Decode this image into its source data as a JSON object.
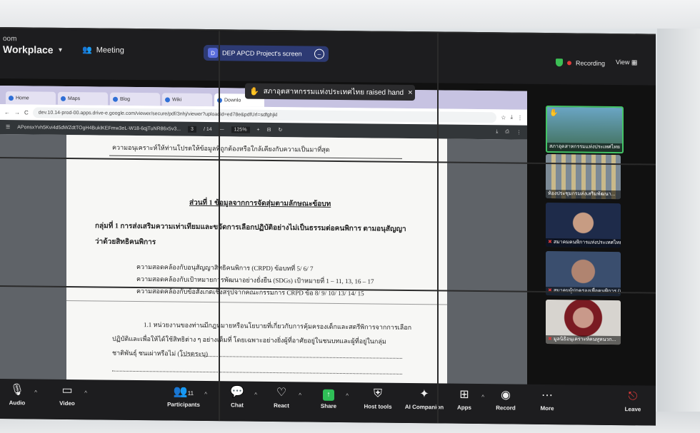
{
  "zoom": {
    "brand_line1": "oom",
    "brand_line2": "Workplace",
    "meeting_label": "Meeting",
    "share_badge": "D",
    "share_title": "DEP APCD Project's screen",
    "recording_label": "Recording",
    "view_label": "View"
  },
  "toast": {
    "text": "สภาอุตสาหกรรมแห่งประเทศไทย raised hand"
  },
  "browser": {
    "tabs": [
      "Home",
      "Maps",
      "Blog",
      "Wiki",
      "Downlo"
    ],
    "url": "dev.10.14-prod-00.apps.drive-e.google.com/viewer/secure/pdf/3nhj/viewer?uploadid=ed78e&pdfUrl=sdfghjkl",
    "pdf_name": "APonsxYvh5Kvi4d5dWZdtTOgH4BuklKEFmw3eL-W18-6qjTuNR86x5v3...",
    "page_current": "3",
    "page_total": "/ 14",
    "zoom": "125%"
  },
  "document": {
    "line_top": "ความอนุเคราะห์ให้ท่านโปรดให้ข้อมูลที่ถูกต้องหรือใกล้เคียงกับความเป็นมาที่สุด",
    "section_title": "ส่วนที่ 1 ข้อมูลจากการจัดสุ่มตามลักษณะข้อบท",
    "group_line1": "กลุ่มที่ 1 การส่งเสริมความเท่าเทียมและขจัดการเลือกปฏิบัติอย่างไม่เป็นธรรมต่อคนพิการ ตามอนุสัญญา",
    "group_line2": "ว่าด้วยสิทธิคนพิการ",
    "bullet1": "ความสอดคล้องกับอนุสัญญาสิทธิคนพิการ (CRPD) ข้อบทที่ 5/ 6/ 7",
    "bullet2": "ความสอดคล้องกับเป้าหมายการพัฒนาอย่างยั่งยืน (SDGs) เป้าหมายที่ 1 – 11, 13, 16 – 17",
    "bullet3": "ความสอดคล้องกับข้อสังเกตเชิงสรุปจากคณะกรรมการ CRPD ข้อ 8/ 9/ 10/ 13/ 14/ 15",
    "para1": "1.1 หน่วยงานของท่านมีกฎหมายหรือนโยบายที่เกี่ยวกับการคุ้มครองเด็กและสตรีพิการจากการเลือก",
    "para2": "ปฏิบัติและเพื่อให้ได้ใช้สิทธิต่าง ๆ อย่างเต็มที่ โดยเฉพาะอย่างยิ่งผู้ที่อาศัยอยู่ในชนบทและผู้ที่อยู่ในกลุ่ม",
    "para3": "ชาติพันธุ์ ชนเผ่าหรือไม่ (โปรดระบุ)"
  },
  "participants": [
    {
      "name": "สภาอุตสาหกรรมแห่งประเทศไทย"
    },
    {
      "name": "ห้องประชุมกรมส่งเสริมพัฒนา..."
    },
    {
      "name": "สมาคมคนพิการแห่งประเทศไทย"
    },
    {
      "name": "สมาคมผู้ปกครองเพื่อคนพิการ (จ)"
    },
    {
      "name": "มูลนิธิอนุเคราะห์คนหูหนวก..."
    }
  ],
  "toolbar": {
    "audio": "Audio",
    "video": "Video",
    "participants": "Participants",
    "participants_count": "11",
    "chat": "Chat",
    "react": "React",
    "share": "Share",
    "host_tools": "Host tools",
    "ai_companion": "AI Companion",
    "apps": "Apps",
    "record": "Record",
    "more": "More",
    "leave": "Leave"
  }
}
